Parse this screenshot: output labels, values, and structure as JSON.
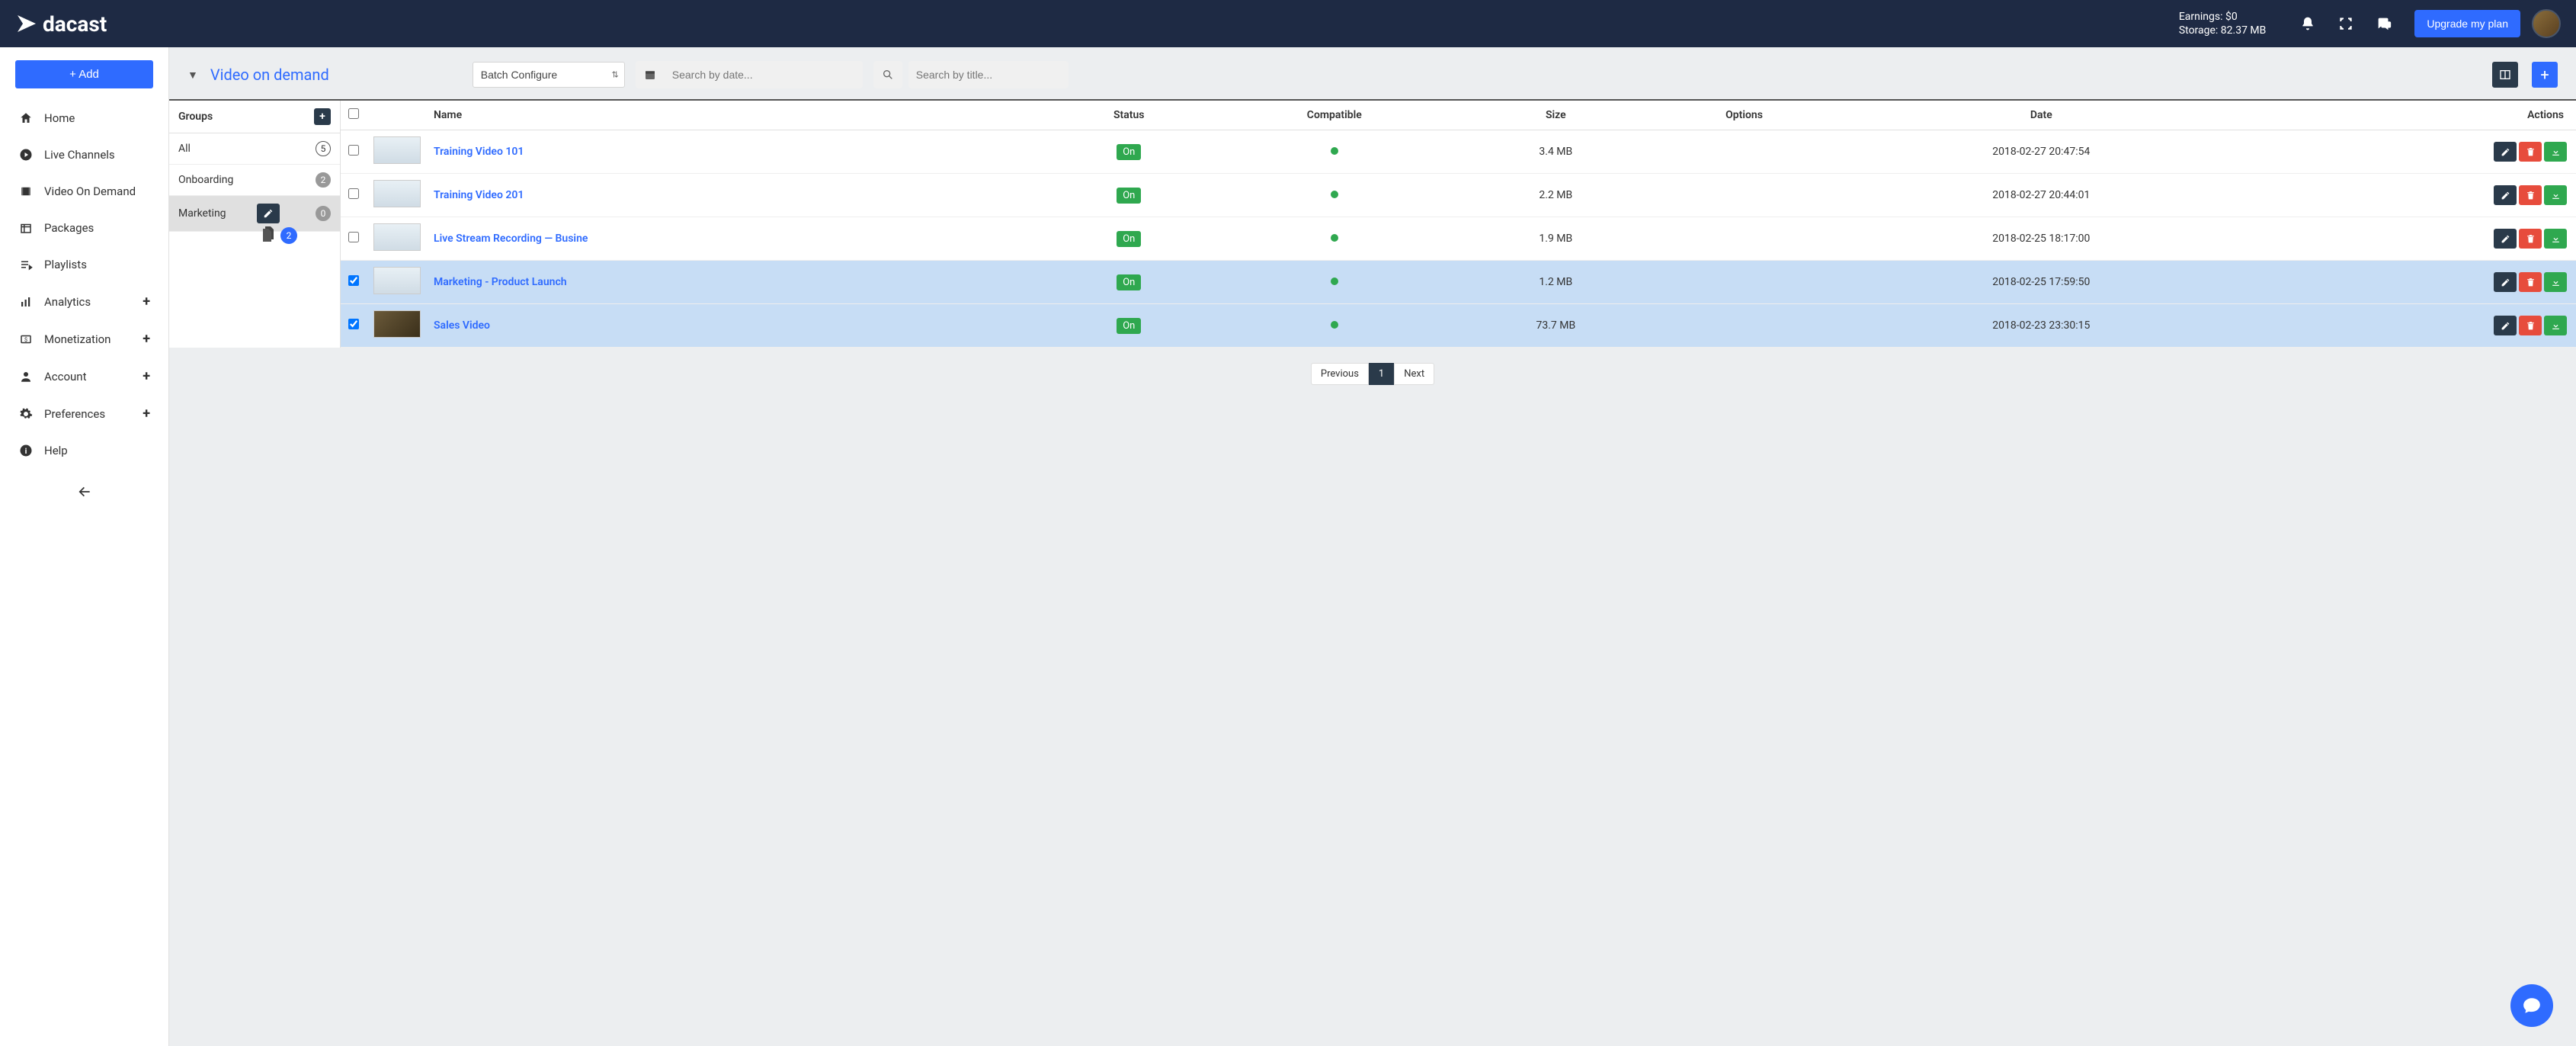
{
  "header": {
    "brand": "dacast",
    "earnings_label": "Earnings: $0",
    "storage_label": "Storage: 82.37 MB",
    "upgrade_label": "Upgrade my plan"
  },
  "sidebar": {
    "add_label": "+ Add",
    "items": [
      {
        "label": "Home"
      },
      {
        "label": "Live Channels"
      },
      {
        "label": "Video On Demand"
      },
      {
        "label": "Packages"
      },
      {
        "label": "Playlists"
      },
      {
        "label": "Analytics",
        "expandable": true
      },
      {
        "label": "Monetization",
        "expandable": true
      },
      {
        "label": " Account",
        "expandable": true
      },
      {
        "label": "Preferences",
        "expandable": true
      },
      {
        "label": "Help"
      }
    ]
  },
  "toolbar": {
    "title": "Video on demand",
    "batch_label": "Batch Configure",
    "search_date_placeholder": "Search by date...",
    "search_title_placeholder": "Search by title..."
  },
  "groups": {
    "header": "Groups",
    "items": [
      {
        "label": "All",
        "count": "5"
      },
      {
        "label": "Onboarding",
        "count": "2"
      },
      {
        "label": "Marketing",
        "count": "0"
      }
    ],
    "drag_count": "2"
  },
  "table": {
    "columns": {
      "name": "Name",
      "status": "Status",
      "compatible": "Compatible",
      "size": "Size",
      "options": "Options",
      "date": "Date",
      "actions": "Actions"
    },
    "rows": [
      {
        "selected": false,
        "name": "Training Video 101",
        "status": "On",
        "size": "3.4 MB",
        "date": "2018-02-27 20:47:54"
      },
      {
        "selected": false,
        "name": "Training Video 201",
        "status": "On",
        "size": "2.2 MB",
        "date": "2018-02-27 20:44:01"
      },
      {
        "selected": false,
        "name": "Live Stream Recording — Busine",
        "status": "On",
        "size": "1.9 MB",
        "date": "2018-02-25 18:17:00"
      },
      {
        "selected": true,
        "name": "Marketing - Product Launch",
        "status": "On",
        "size": "1.2 MB",
        "date": "2018-02-25 17:59:50"
      },
      {
        "selected": true,
        "name": "Sales Video",
        "status": "On",
        "size": "73.7 MB",
        "date": "2018-02-23 23:30:15",
        "dark_thumb": true
      }
    ]
  },
  "pagination": {
    "prev": "Previous",
    "pages": [
      "1"
    ],
    "next": "Next"
  }
}
